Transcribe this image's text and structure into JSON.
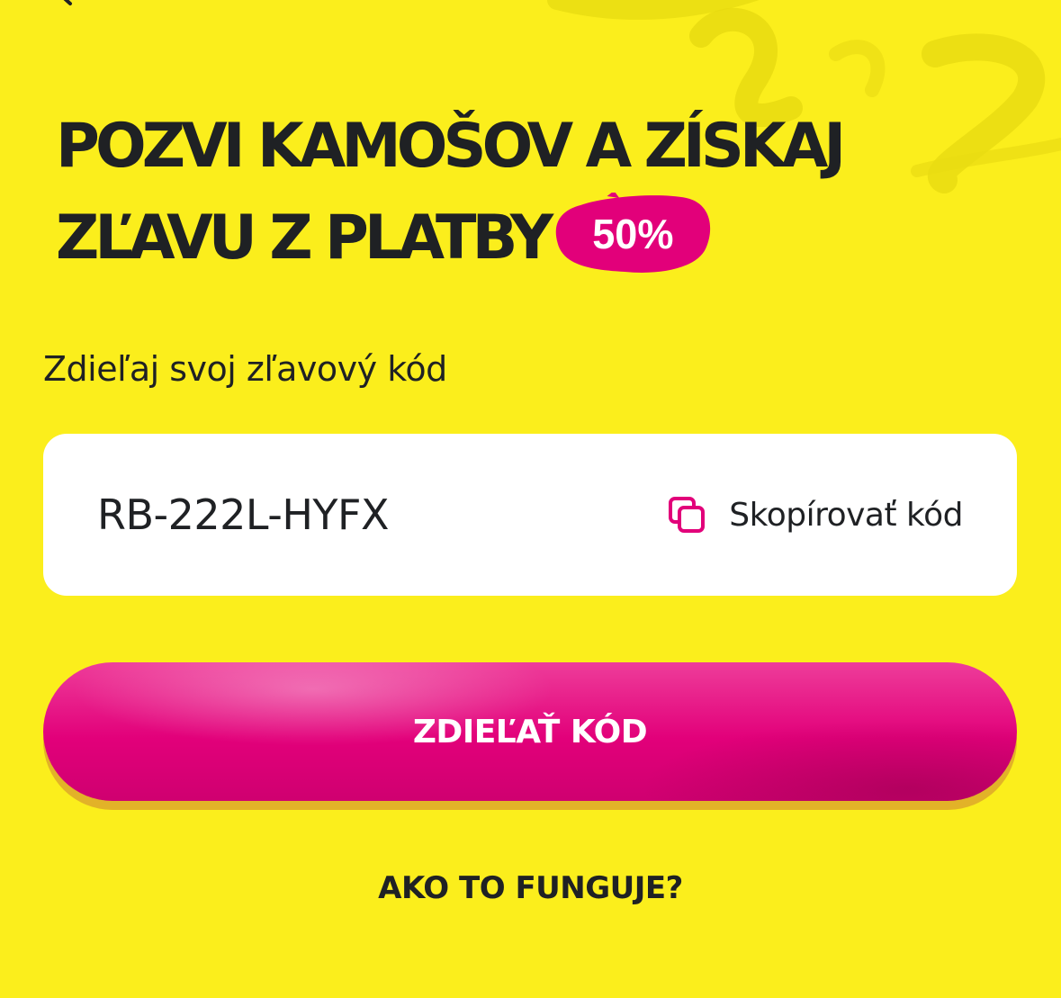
{
  "headline": {
    "line1": "POZVI KAMOŠOV A ZÍSKAJ",
    "line2": "ZĽAVU Z PLATBY",
    "badge": "50%"
  },
  "subtitle": "Zdieľaj svoj zľavový kód",
  "code_card": {
    "code": "RB-222L-HYFX",
    "copy_label": "Skopírovať kód",
    "copy_icon": "copy-icon"
  },
  "share_button": {
    "label": "ZDIEĽAŤ KÓD"
  },
  "how_link": "AKO TO FUNGUJE?",
  "colors": {
    "background": "#fbee1c",
    "accent_magenta": "#e2007a",
    "text_dark": "#1f2124",
    "card_white": "#ffffff"
  }
}
